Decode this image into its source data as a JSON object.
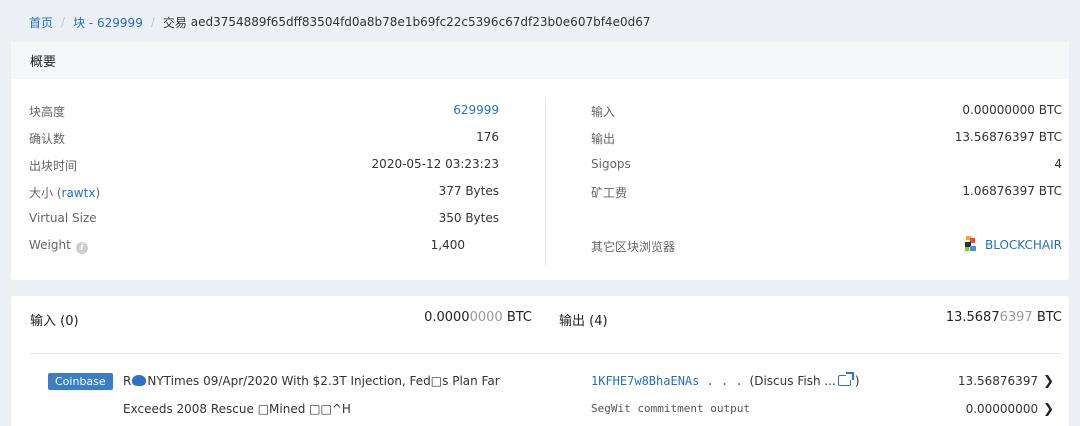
{
  "breadcrumb": {
    "home": "首页",
    "block": "块 - 629999",
    "current_prefix": "交易",
    "txid": "aed3754889f65dff83504fd0a8b78e1b69fc22c5396c67df23b0e607bf4e0d67"
  },
  "summary": {
    "title": "概要",
    "left": {
      "height_label": "块高度",
      "height_value": "629999",
      "confirm_label": "确认数",
      "confirm_value": "176",
      "time_label": "出块时间",
      "time_value": "2020-05-12 03:23:23",
      "size_label": "大小",
      "rawtx_link": "rawtx",
      "size_value": "377 Bytes",
      "vsize_label": "Virtual Size",
      "vsize_value": "350 Bytes",
      "weight_label": "Weight",
      "weight_value": "1,400"
    },
    "right": {
      "input_label": "输入",
      "input_value": "0.00000000 BTC",
      "output_label": "输出",
      "output_value": "13.56876397 BTC",
      "sigops_label": "Sigops",
      "sigops_value": "4",
      "fee_label": "矿工费",
      "fee_value": "1.06876397 BTC",
      "explorer_label": "其它区块浏览器",
      "explorer_link": "BLOCKCHAIR"
    }
  },
  "io": {
    "inputs_title": "输入 (0)",
    "inputs_total_main": "0.0000",
    "inputs_total_dim": "0000",
    "inputs_total_unit": " BTC",
    "outputs_title": "输出 (4)",
    "outputs_total_main": "13.5687",
    "outputs_total_dim": "6397",
    "outputs_total_unit": " BTC",
    "coinbase_badge": "Coinbase",
    "coinbase_line1_a": "R",
    "coinbase_line1_b": "NYTimes 09/Apr/2020 With $2.3T Injection, Fed□s Plan Far",
    "coinbase_line2": "Exceeds 2008 Rescue □Mined □□^H",
    "outputs": [
      {
        "address": "1KFHE7w8BhaENAs . . .",
        "tag": "(Discus Fish ...",
        "tag_end": ")",
        "amount": "13.56876397"
      },
      {
        "address": "SegWit commitment output",
        "amount": "0.00000000"
      }
    ]
  },
  "colors": {
    "link": "#1f6fc5",
    "badge": "#3a7fc4",
    "page_bg": "#eceff3"
  }
}
